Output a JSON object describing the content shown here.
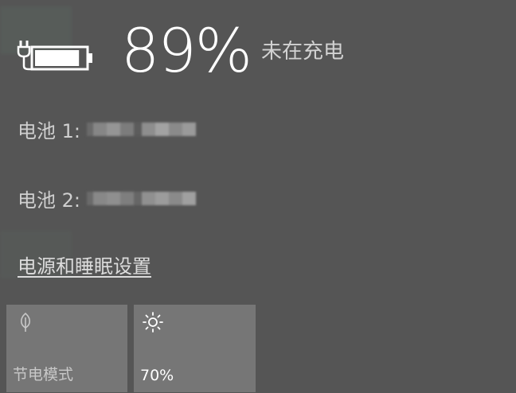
{
  "battery": {
    "percent_text": "89%",
    "level": 0.89,
    "status": "未在充电",
    "icon": "battery-plugged-icon"
  },
  "batteries": [
    {
      "label": "电池 1:"
    },
    {
      "label": "电池 2:"
    }
  ],
  "settings_link": "电源和睡眠设置",
  "quick_actions": [
    {
      "label": "节电模式",
      "icon": "leaf-icon"
    },
    {
      "label": "70%",
      "icon": "brightness-icon"
    }
  ],
  "colors": {
    "background": "#555555",
    "tile": "#767676",
    "text": "#ffffff",
    "muted_text": "#cfcfcf"
  }
}
